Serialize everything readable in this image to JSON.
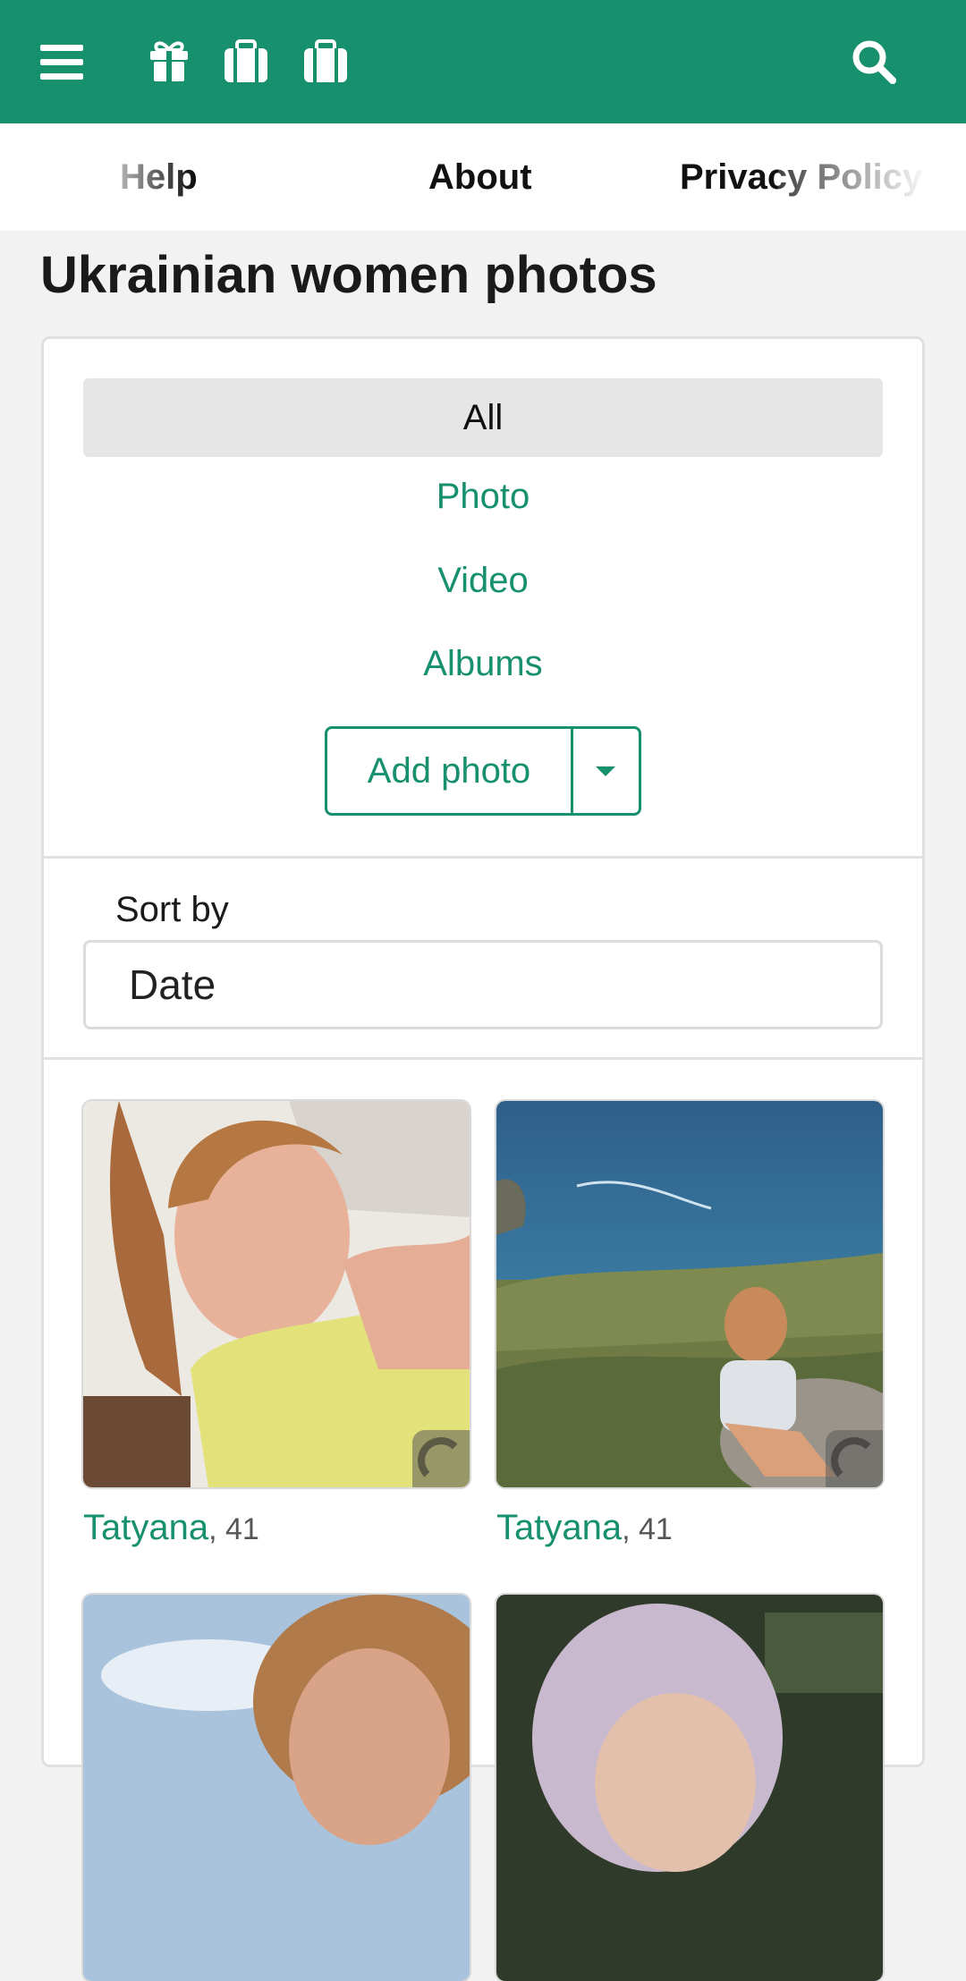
{
  "header": {
    "icons": [
      "menu-icon",
      "gift-icon",
      "briefcase-icon",
      "briefcase-icon",
      "search-icon"
    ],
    "accent_color": "#17906e"
  },
  "subnav": {
    "help": "Help",
    "about": "About",
    "privacy": "Privacy Policy"
  },
  "page": {
    "title": "Ukrainian women photos"
  },
  "filters": {
    "all": "All",
    "photo": "Photo",
    "video": "Video",
    "albums": "Albums",
    "active": "All"
  },
  "actions": {
    "add_photo": "Add photo"
  },
  "sort": {
    "label": "Sort by",
    "value": "Date"
  },
  "photos": [
    {
      "name": "Tatyana",
      "age": ", 41"
    },
    {
      "name": "Tatyana",
      "age": ", 41"
    },
    {
      "name": "",
      "age": ""
    },
    {
      "name": "",
      "age": ""
    }
  ]
}
